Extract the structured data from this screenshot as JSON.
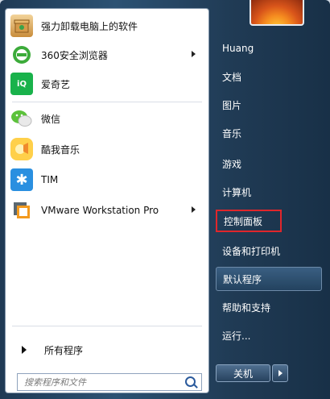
{
  "pinned_programs": [
    {
      "label": "强力卸载电脑上的软件",
      "icon": "uninstall-box-icon"
    },
    {
      "label": "360安全浏览器",
      "icon": "360-browser-icon",
      "has_submenu": true
    },
    {
      "label": "爱奇艺",
      "icon": "iqiyi-icon"
    }
  ],
  "recent_programs": [
    {
      "label": "微信",
      "icon": "wechat-icon"
    },
    {
      "label": "酷我音乐",
      "icon": "kuwo-music-icon"
    },
    {
      "label": "TIM",
      "icon": "tim-icon"
    },
    {
      "label": "VMware Workstation Pro",
      "icon": "vmware-icon",
      "has_submenu": true
    }
  ],
  "all_programs_label": "所有程序",
  "search": {
    "placeholder": "搜索程序和文件"
  },
  "right_menu": [
    {
      "label": "Huang"
    },
    {
      "label": "文档"
    },
    {
      "label": "图片"
    },
    {
      "label": "音乐"
    },
    {
      "label": "游戏"
    },
    {
      "label": "计算机"
    },
    {
      "label": "控制面板",
      "highlighted_box": true
    },
    {
      "label": "设备和打印机"
    },
    {
      "label": "默认程序",
      "hovered": true
    },
    {
      "label": "帮助和支持"
    },
    {
      "label": "运行..."
    }
  ],
  "shutdown_label": "关机",
  "colors": {
    "highlight_box": "#e0262b"
  }
}
